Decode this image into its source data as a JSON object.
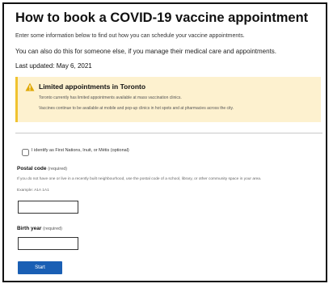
{
  "page": {
    "title": "How to book a COVID-19 vaccine appointment",
    "intro_1": "Enter some information below to find out how you can schedule your vaccine appointments.",
    "intro_2": "You can also do this for someone else, if you manage their medical care and appointments.",
    "last_updated": "Last updated: May 6, 2021"
  },
  "alert": {
    "icon": "warning-icon",
    "title": "Limited appointments in Toronto",
    "line_1": "Toronto currently has limited appointments available at mass vaccination clinics.",
    "line_2": "Vaccines continue to be available at mobile and pop-up clinics in hot spots and at pharmacies across the city.",
    "background_color": "#fdf1cf",
    "accent_color": "#f0c330"
  },
  "form": {
    "checkbox_label": "I identify as First Nations, Inuit, or Métis (optional)",
    "postal": {
      "label": "Postal code",
      "required": "(required)",
      "hint": "If you do not have one or live in a recently built neighbourhood, use the postal code of a school, library, or other community space in your area.",
      "example": "Example: A1A 1A1",
      "value": ""
    },
    "birth": {
      "label": "Birth year",
      "required": "(required)",
      "value": ""
    },
    "start_label": "Start",
    "button_color": "#1a5fb4"
  }
}
